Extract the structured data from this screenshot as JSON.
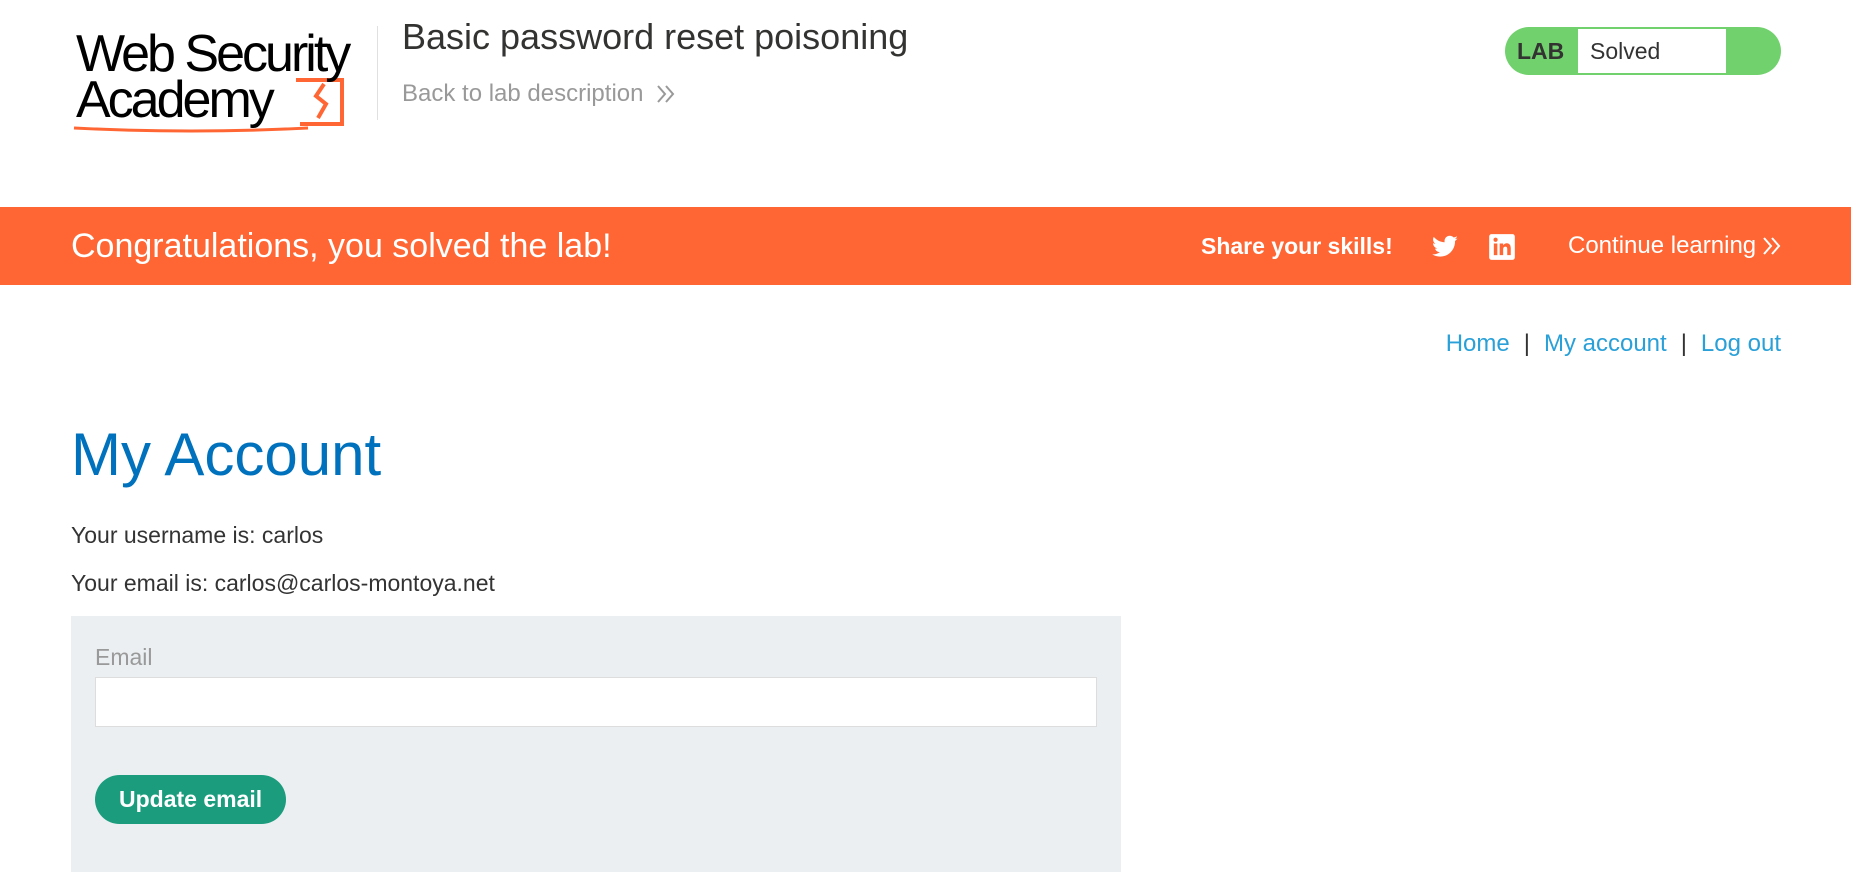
{
  "header": {
    "logo_line1": "Web Security",
    "logo_line2": "Academy",
    "lab_title": "Basic password reset poisoning",
    "back_link": "Back to lab description",
    "status_label": "LAB",
    "status_value": "Solved"
  },
  "banner": {
    "message": "Congratulations, you solved the lab!",
    "share": "Share your skills!",
    "continue": "Continue learning",
    "social_icons": [
      "twitter-icon",
      "linkedin-icon"
    ]
  },
  "nav": {
    "home": "Home",
    "my_account": "My account",
    "log_out": "Log out",
    "separator": "|"
  },
  "main": {
    "heading": "My Account",
    "username_line": "Your username is: carlos",
    "email_line": "Your email is: carlos@carlos-montoya.net",
    "form": {
      "email_label": "Email",
      "email_value": "",
      "submit_label": "Update email"
    }
  },
  "colors": {
    "accent_orange": "#ff6633",
    "solved_green": "#70d16d",
    "heading_blue": "#0071bc",
    "link_blue": "#29a0d8",
    "button_teal": "#1a9c7d",
    "form_bg": "#ebeff2"
  }
}
